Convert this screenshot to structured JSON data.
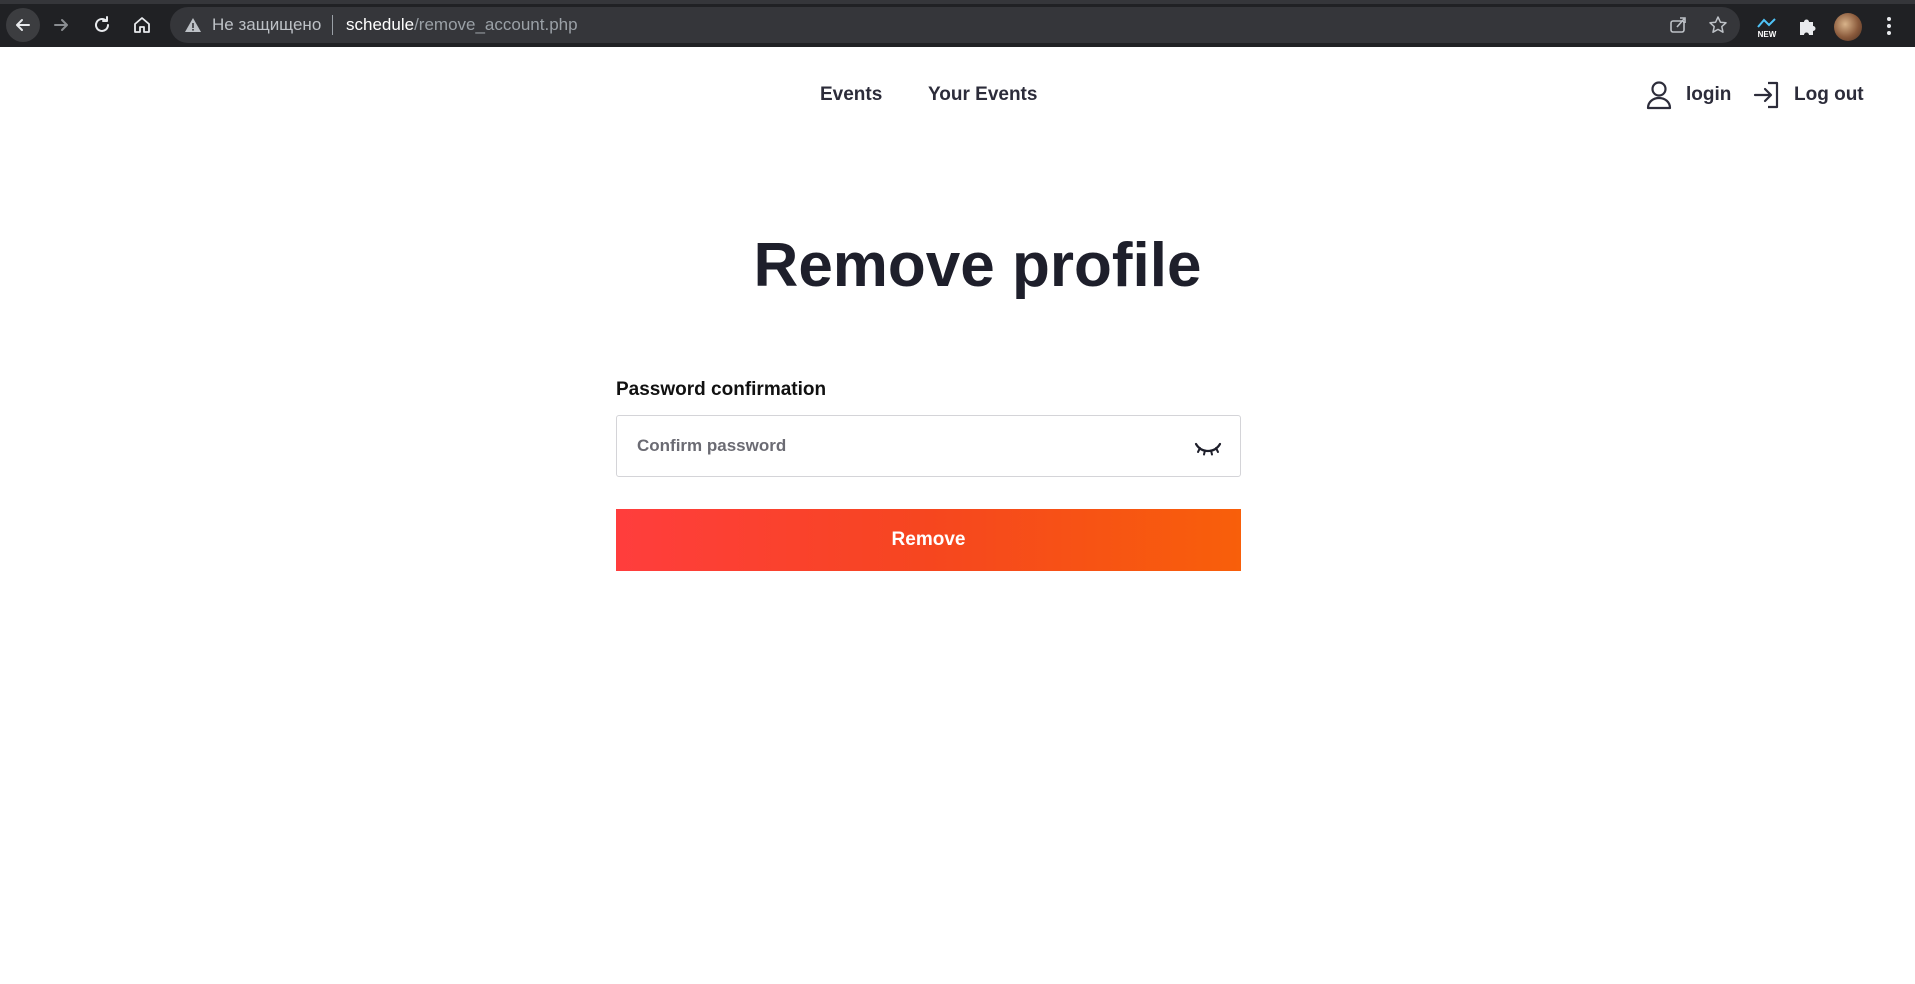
{
  "browser": {
    "insecure_label": "Не защищено",
    "url_host": "schedule",
    "url_path": "/remove_account.php",
    "extension_badge": "NEW"
  },
  "header": {
    "nav": [
      {
        "label": "Events"
      },
      {
        "label": "Your Events"
      }
    ],
    "login_label": "login",
    "logout_label": "Log out"
  },
  "main": {
    "title": "Remove profile",
    "password_label": "Password confirmation",
    "password_placeholder": "Confirm password",
    "submit_label": "Remove"
  },
  "colors": {
    "button_gradient_start": "#ff3d3d",
    "button_gradient_end": "#f85f0a",
    "text_dark": "#1e1f2b"
  }
}
